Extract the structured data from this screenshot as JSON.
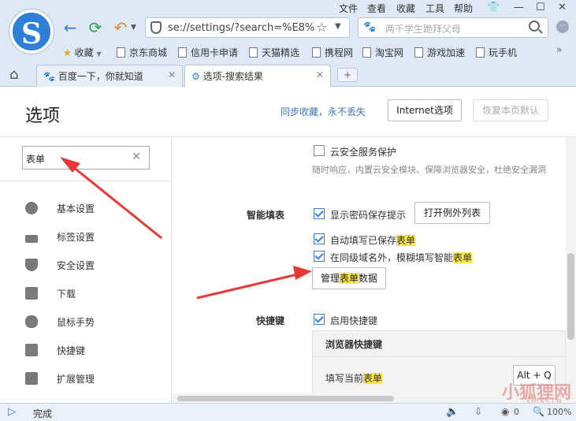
{
  "browser": {
    "menu": [
      "文件",
      "查看",
      "收藏",
      "工具",
      "帮助"
    ],
    "address": "se://settings/?search=%E8%",
    "search_placeholder": "两千学生跪拜父母",
    "bookmarks_label": "收藏",
    "bookmarks": [
      "京东商城",
      "信用卡申请",
      "天猫精选",
      "携程网",
      "淘宝网",
      "游戏加速",
      "玩手机"
    ],
    "tabs": [
      {
        "label": "百度一下，你就知道",
        "active": false
      },
      {
        "label": "选项-搜索结果",
        "active": true
      }
    ],
    "status": "完成",
    "status_count": "0",
    "zoom": "100%"
  },
  "page": {
    "title": "选项",
    "sync_link": "同步收藏，永不丢失",
    "internet_options": "Internet选项",
    "restore_default": "恢复本页默认"
  },
  "sidebar": {
    "search_value": "表单",
    "clear": "✕",
    "items": [
      "基本设置",
      "标签设置",
      "安全设置",
      "下载",
      "鼠标手势",
      "快捷键",
      "扩展管理"
    ]
  },
  "content": {
    "cloud_security": "云安全服务保护",
    "cloud_desc": "随时响应，内置云安全模块、保障浏览器安全，杜绝安全漏洞",
    "autofill_label": "智能填表",
    "show_pwd_prompt": "显示密码保存提示",
    "open_exceptions": "打开例外列表",
    "autofill_saved_prefix": "自动填写已保存",
    "autofill_saved_hl": "表单",
    "fuzzy_prefix": "在同级域名外，模糊填写智能",
    "fuzzy_hl": "表单",
    "manage_prefix": "管理",
    "manage_hl": "表单",
    "manage_suffix": "数据",
    "hotkey_label": "快捷键",
    "enable_hotkey": "启用快捷键",
    "hotkey_header": "浏览器快捷键",
    "fill_form_prefix": "填写当前",
    "fill_form_hl": "表单",
    "fill_form_key": "Alt + Q"
  },
  "watermark": {
    "text": "小狐狸网",
    "sub": "XHLKS.CN"
  },
  "colors": {
    "highlight": "#fbe74a",
    "accent": "#3c7fd0",
    "arrow": "#e53935"
  }
}
